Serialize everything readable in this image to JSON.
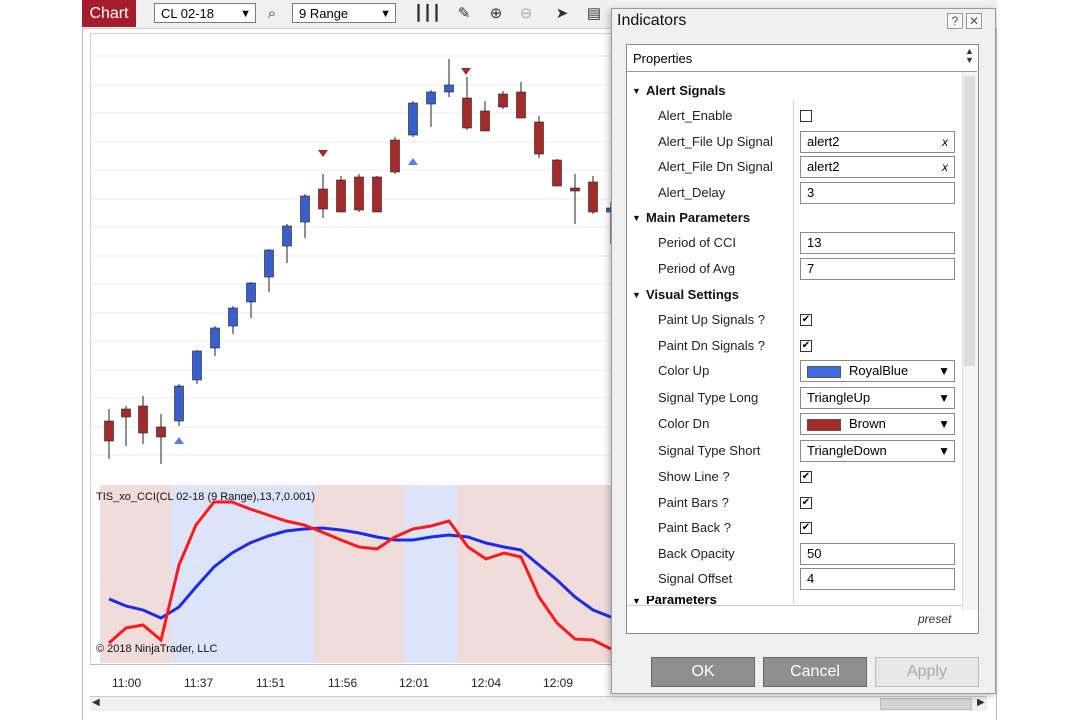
{
  "toolbar": {
    "chart_tab": "Chart",
    "instrument": "CL 02-18",
    "bar_type": "9 Range"
  },
  "chart": {
    "indicator_label": "TIS_xo_CCI(CL 02-18 (9 Range),13,7,0.001)",
    "copyright": "© 2018 NinjaTrader, LLC",
    "time_labels": [
      "11:00",
      "11:37",
      "11:51",
      "11:56",
      "12:01",
      "12:04",
      "12:09"
    ],
    "colors": {
      "up": "#3a5fcd",
      "down": "#a52a2a",
      "cci": "#ff1a1a",
      "avg": "#1a2ee6",
      "back_up": "#dde3f8",
      "back_dn": "#f1dcdc"
    }
  },
  "dialog": {
    "title": "Indicators",
    "help": "?",
    "close": "✕",
    "properties_header": "Properties",
    "categories": {
      "alert": "Alert Signals",
      "main": "Main Parameters",
      "visual": "Visual Settings",
      "params": "Parameters"
    },
    "props": {
      "alert_enable": {
        "label": "Alert_Enable"
      },
      "alert_file_up": {
        "label": "Alert_File Up Signal",
        "value": "alert2"
      },
      "alert_file_dn": {
        "label": "Alert_File Dn Signal",
        "value": "alert2"
      },
      "alert_delay": {
        "label": "Alert_Delay",
        "value": "3"
      },
      "period_cci": {
        "label": "Period of CCI",
        "value": "13"
      },
      "period_avg": {
        "label": "Period of Avg",
        "value": "7"
      },
      "paint_up": {
        "label": "Paint Up Signals ?"
      },
      "paint_dn": {
        "label": "Paint Dn Signals ?"
      },
      "color_up": {
        "label": "Color Up",
        "value": "RoyalBlue"
      },
      "signal_long": {
        "label": "Signal Type Long",
        "value": "TriangleUp"
      },
      "color_dn": {
        "label": "Color Dn",
        "value": "Brown"
      },
      "signal_short": {
        "label": "Signal Type Short",
        "value": "TriangleDown"
      },
      "show_line": {
        "label": "Show Line ?"
      },
      "paint_bars": {
        "label": "Paint Bars ?"
      },
      "paint_back": {
        "label": "Paint Back ?"
      },
      "back_opacity": {
        "label": "Back Opacity",
        "value": "50"
      },
      "signal_offset": {
        "label": "Signal Offset",
        "value": "4"
      }
    },
    "preset": "preset",
    "buttons": {
      "ok": "OK",
      "cancel": "Cancel",
      "apply": "Apply"
    },
    "clear_x": "x",
    "checkmark": "✔"
  }
}
